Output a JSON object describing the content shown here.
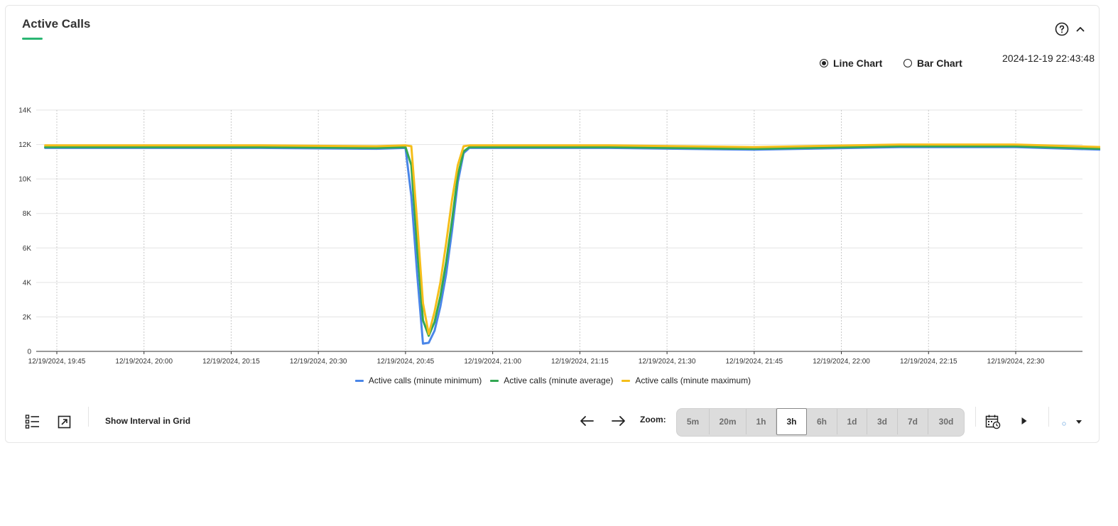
{
  "panel": {
    "title": "Active Calls",
    "timestamp": "2024-12-19 22:43:48",
    "help_icon": "question-circle-icon",
    "collapse_icon": "chevron-up-icon"
  },
  "chart_type_options": {
    "line_label": "Line Chart",
    "bar_label": "Bar Chart",
    "selected": "Line Chart"
  },
  "colors": {
    "accent": "#2bb673",
    "min": "#4a86e8",
    "avg": "#33a853",
    "max": "#f5be1a"
  },
  "toolbar": {
    "list_icon": "list-icon",
    "expand_icon": "open-external-icon",
    "show_interval_label": "Show Interval in Grid",
    "prev_icon": "arrow-left-icon",
    "next_icon": "arrow-right-icon",
    "zoom_label": "Zoom:",
    "zoom_options": [
      "5m",
      "20m",
      "1h",
      "3h",
      "6h",
      "1d",
      "3d",
      "7d",
      "30d"
    ],
    "zoom_selected": "3h",
    "calendar_icon": "calendar-clock-icon",
    "play_icon": "play-icon",
    "refresh_select_icon": "dot-dropdown-icon"
  },
  "chart_data": {
    "type": "line",
    "yticks": [
      "0",
      "2K",
      "4K",
      "6K",
      "8K",
      "10K",
      "12K",
      "14K"
    ],
    "ylim": [
      0,
      14000
    ],
    "xlim": [
      "12/19/2024, 19:45",
      "12/19/2024, 22:45"
    ],
    "xticks": [
      "12/19/2024, 19:45",
      "12/19/2024, 20:00",
      "12/19/2024, 20:15",
      "12/19/2024, 20:30",
      "12/19/2024, 20:45",
      "12/19/2024, 21:00",
      "12/19/2024, 21:15",
      "12/19/2024, 21:30",
      "12/19/2024, 21:45",
      "12/19/2024, 22:00",
      "12/19/2024, 22:15",
      "12/19/2024, 22:30"
    ],
    "grid": true,
    "legend_position": "bottom-center",
    "series": [
      {
        "name": "Active calls (minute minimum)",
        "points": [
          [
            "12/19/2024, 19:43",
            11800
          ],
          [
            "12/19/2024, 20:00",
            11800
          ],
          [
            "12/19/2024, 20:20",
            11800
          ],
          [
            "12/19/2024, 20:40",
            11750
          ],
          [
            "12/19/2024, 20:45",
            11800
          ],
          [
            "12/19/2024, 20:46",
            9000
          ],
          [
            "12/19/2024, 20:47",
            4500
          ],
          [
            "12/19/2024, 20:48",
            450
          ],
          [
            "12/19/2024, 20:49",
            500
          ],
          [
            "12/19/2024, 20:50",
            1200
          ],
          [
            "12/19/2024, 20:51",
            2600
          ],
          [
            "12/19/2024, 20:52",
            4500
          ],
          [
            "12/19/2024, 20:53",
            7000
          ],
          [
            "12/19/2024, 20:54",
            9800
          ],
          [
            "12/19/2024, 20:55",
            11500
          ],
          [
            "12/19/2024, 20:56",
            11800
          ],
          [
            "12/19/2024, 21:20",
            11800
          ],
          [
            "12/19/2024, 21:45",
            11700
          ],
          [
            "12/19/2024, 22:10",
            11850
          ],
          [
            "12/19/2024, 22:30",
            11850
          ],
          [
            "12/19/2024, 22:45",
            11700
          ]
        ]
      },
      {
        "name": "Active calls (minute average)",
        "points": [
          [
            "12/19/2024, 19:43",
            11850
          ],
          [
            "12/19/2024, 20:00",
            11850
          ],
          [
            "12/19/2024, 20:20",
            11850
          ],
          [
            "12/19/2024, 20:40",
            11800
          ],
          [
            "12/19/2024, 20:45",
            11850
          ],
          [
            "12/19/2024, 20:46",
            10800
          ],
          [
            "12/19/2024, 20:47",
            6000
          ],
          [
            "12/19/2024, 20:48",
            1800
          ],
          [
            "12/19/2024, 20:49",
            900
          ],
          [
            "12/19/2024, 20:50",
            1700
          ],
          [
            "12/19/2024, 20:51",
            3200
          ],
          [
            "12/19/2024, 20:52",
            5200
          ],
          [
            "12/19/2024, 20:53",
            7600
          ],
          [
            "12/19/2024, 20:54",
            10200
          ],
          [
            "12/19/2024, 20:55",
            11600
          ],
          [
            "12/19/2024, 20:56",
            11850
          ],
          [
            "12/19/2024, 21:20",
            11850
          ],
          [
            "12/19/2024, 21:45",
            11750
          ],
          [
            "12/19/2024, 22:10",
            11900
          ],
          [
            "12/19/2024, 22:30",
            11900
          ],
          [
            "12/19/2024, 22:45",
            11750
          ]
        ]
      },
      {
        "name": "Active calls (minute maximum)",
        "points": [
          [
            "12/19/2024, 19:43",
            11950
          ],
          [
            "12/19/2024, 20:00",
            11950
          ],
          [
            "12/19/2024, 20:20",
            11950
          ],
          [
            "12/19/2024, 20:40",
            11900
          ],
          [
            "12/19/2024, 20:45",
            11950
          ],
          [
            "12/19/2024, 20:46",
            11900
          ],
          [
            "12/19/2024, 20:47",
            7500
          ],
          [
            "12/19/2024, 20:48",
            2800
          ],
          [
            "12/19/2024, 20:49",
            1000
          ],
          [
            "12/19/2024, 20:50",
            2300
          ],
          [
            "12/19/2024, 20:51",
            4000
          ],
          [
            "12/19/2024, 20:52",
            6300
          ],
          [
            "12/19/2024, 20:53",
            8800
          ],
          [
            "12/19/2024, 20:54",
            10800
          ],
          [
            "12/19/2024, 20:55",
            11900
          ],
          [
            "12/19/2024, 20:56",
            11950
          ],
          [
            "12/19/2024, 21:20",
            11950
          ],
          [
            "12/19/2024, 21:45",
            11850
          ],
          [
            "12/19/2024, 22:10",
            12000
          ],
          [
            "12/19/2024, 22:30",
            12000
          ],
          [
            "12/19/2024, 22:45",
            11850
          ]
        ]
      }
    ]
  }
}
